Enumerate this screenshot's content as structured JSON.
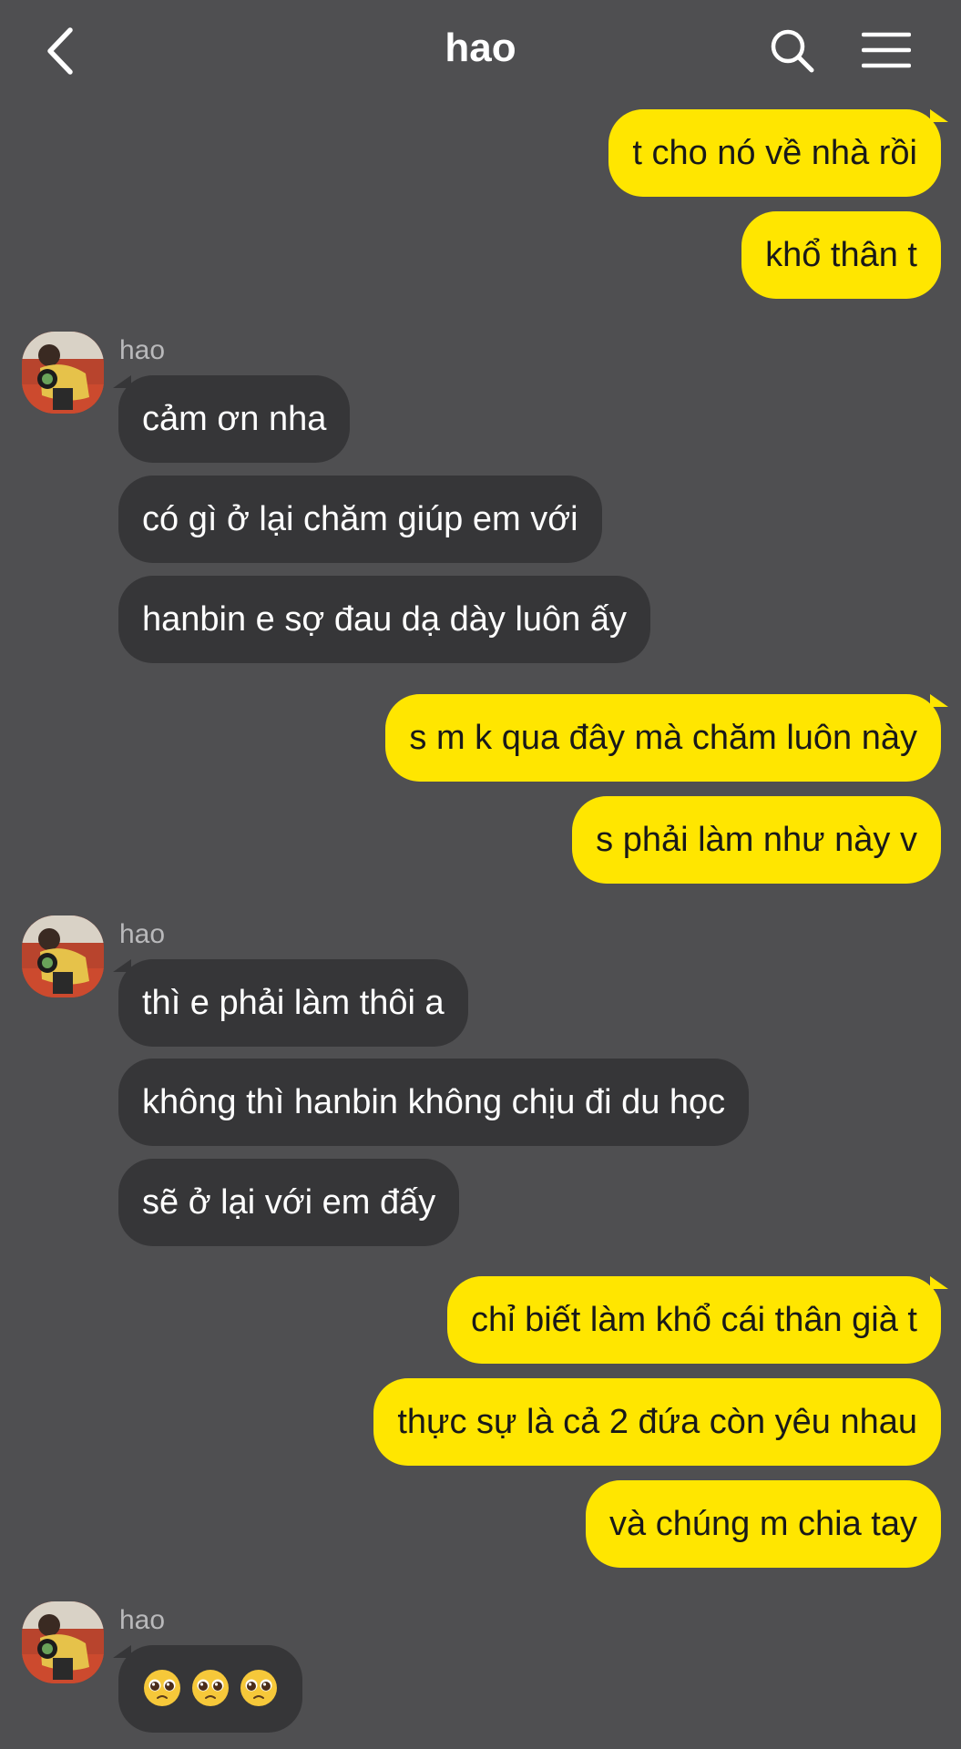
{
  "header": {
    "title": "hao"
  },
  "messages": [
    {
      "type": "out",
      "text": "t cho nó về nhà rồi"
    },
    {
      "type": "out",
      "text": "khổ thân t"
    },
    {
      "type": "sender",
      "name": "hao"
    },
    {
      "type": "in",
      "text": "cảm ơn nha"
    },
    {
      "type": "in",
      "text": "có gì ở lại chăm giúp em với"
    },
    {
      "type": "in",
      "text": "hanbin e sợ đau dạ dày luôn ấy"
    },
    {
      "type": "out",
      "text": "s m k qua đây mà chăm luôn này"
    },
    {
      "type": "out",
      "text": "s phải làm như này v"
    },
    {
      "type": "sender",
      "name": "hao"
    },
    {
      "type": "in",
      "text": "thì e phải làm thôi a"
    },
    {
      "type": "in",
      "text": "không thì hanbin không chịu đi du học"
    },
    {
      "type": "in",
      "text": "sẽ ở lại với em đấy"
    },
    {
      "type": "out",
      "text": "chỉ biết làm khổ cái thân già t"
    },
    {
      "type": "out",
      "text": "thực sự là cả 2 đứa còn yêu nhau"
    },
    {
      "type": "out",
      "text": "và chúng m chia tay"
    },
    {
      "type": "sender",
      "name": "hao"
    },
    {
      "type": "in-emoji",
      "emojis": [
        "pleading-face",
        "pleading-face",
        "pleading-face"
      ]
    }
  ],
  "colors": {
    "background": "#4f4f51",
    "outgoing_bubble": "#ffe600",
    "incoming_bubble": "#363638"
  }
}
